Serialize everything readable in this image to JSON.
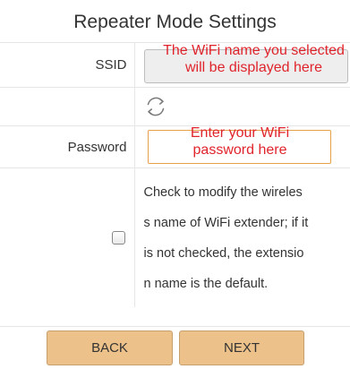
{
  "title": "Repeater Mode Settings",
  "ssid": {
    "label": "SSID",
    "hint_line1": "The WiFi name you selected",
    "hint_line2": "will be displayed here"
  },
  "refresh": {
    "icon": "refresh-icon"
  },
  "password": {
    "label": "Password",
    "hint_line1": "Enter your WiFi",
    "hint_line2": "password here"
  },
  "extender": {
    "checked": false,
    "text_lines": [
      "Check to modify the wireles",
      "s name of WiFi extender; if it",
      "is not checked, the extensio",
      "n name is the default."
    ]
  },
  "buttons": {
    "back_label": "BACK",
    "next_label": "NEXT",
    "color": "#edc18a"
  },
  "colors": {
    "hint_text": "#e0242c",
    "input_border_active": "#e6a14c"
  }
}
